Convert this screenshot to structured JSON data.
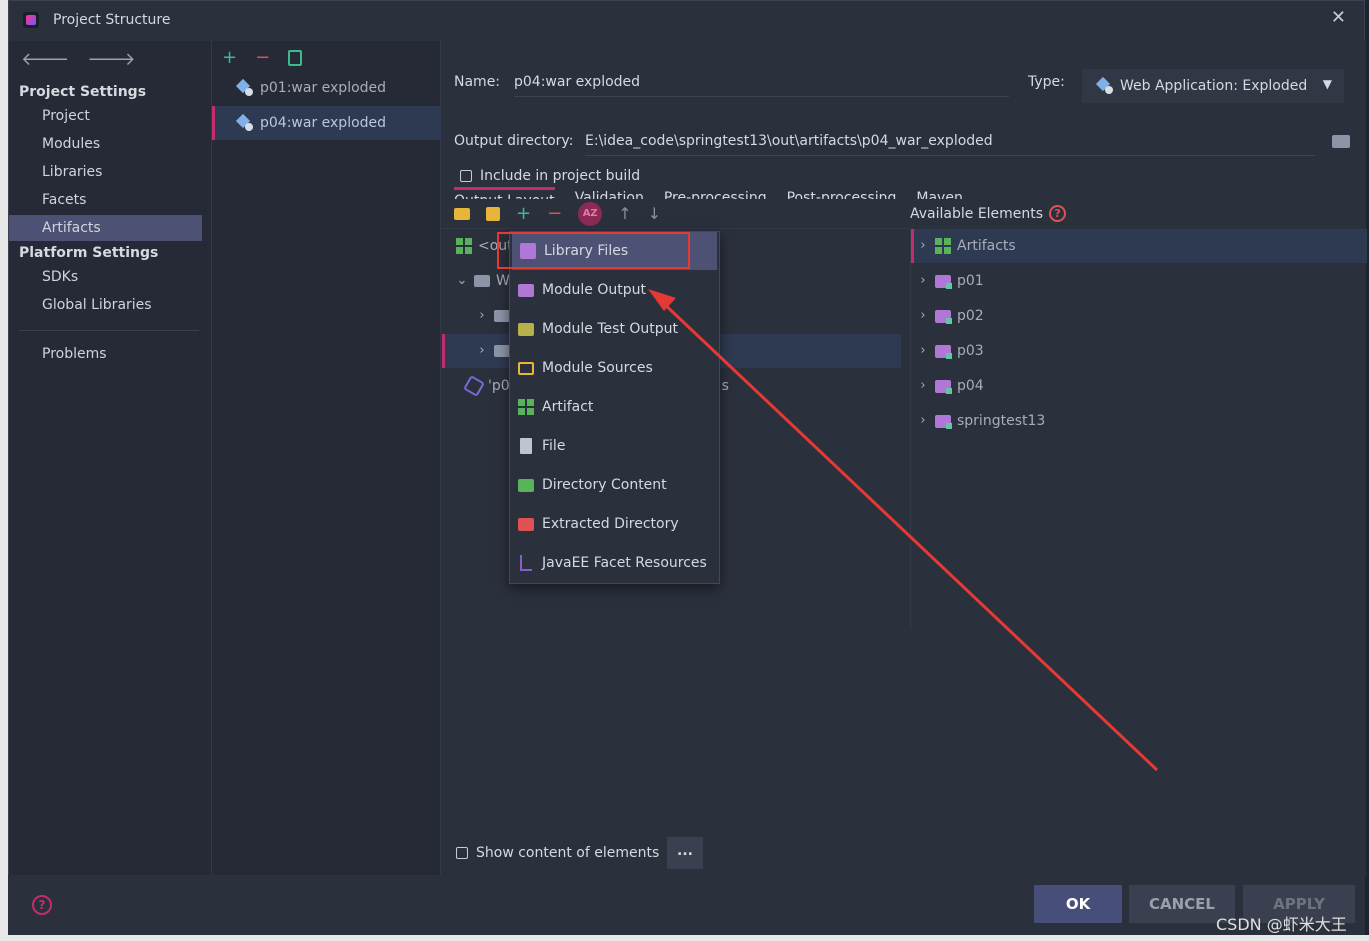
{
  "window": {
    "title": "Project Structure"
  },
  "nav": {
    "project_settings_heading": "Project Settings",
    "project_items": [
      "Project",
      "Modules",
      "Libraries",
      "Facets",
      "Artifacts"
    ],
    "platform_settings_heading": "Platform Settings",
    "platform_items": [
      "SDKs",
      "Global Libraries"
    ],
    "problems": "Problems",
    "selected": "Artifacts"
  },
  "artifacts": {
    "items": [
      "p01:war exploded",
      "p04:war exploded"
    ],
    "selected": "p04:war exploded"
  },
  "main": {
    "name_label": "Name:",
    "name_value": "p04:war exploded",
    "type_label": "Type:",
    "type_value": "Web Application: Exploded",
    "output_label": "Output directory:",
    "output_value": "E:\\idea_code\\springtest13\\out\\artifacts\\p04_war_exploded",
    "include_build_label": "Include in project build",
    "tabs": [
      "Output Layout",
      "Validation",
      "Pre-processing",
      "Post-processing",
      "Maven"
    ],
    "tree": [
      "<outp",
      "WE",
      "'p0"
    ],
    "tree_suffix": "s",
    "show_content_label": "Show content of elements",
    "more_button": "...",
    "available_title": "Available Elements",
    "available_items": [
      "Artifacts",
      "p01",
      "p02",
      "p03",
      "p04",
      "springtest13"
    ]
  },
  "popup_menu": {
    "items": [
      "Library Files",
      "Module Output",
      "Module Test Output",
      "Module Sources",
      "Artifact",
      "File",
      "Directory Content",
      "Extracted Directory",
      "JavaEE Facet Resources"
    ],
    "highlighted": "Library Files"
  },
  "footer": {
    "ok": "OK",
    "cancel": "CANCEL",
    "apply": "APPLY"
  },
  "watermark": "CSDN @虾米大王",
  "colors": {
    "accent": "#c22d6a",
    "selection": "#4d5275",
    "annotation_red": "#e53935"
  }
}
